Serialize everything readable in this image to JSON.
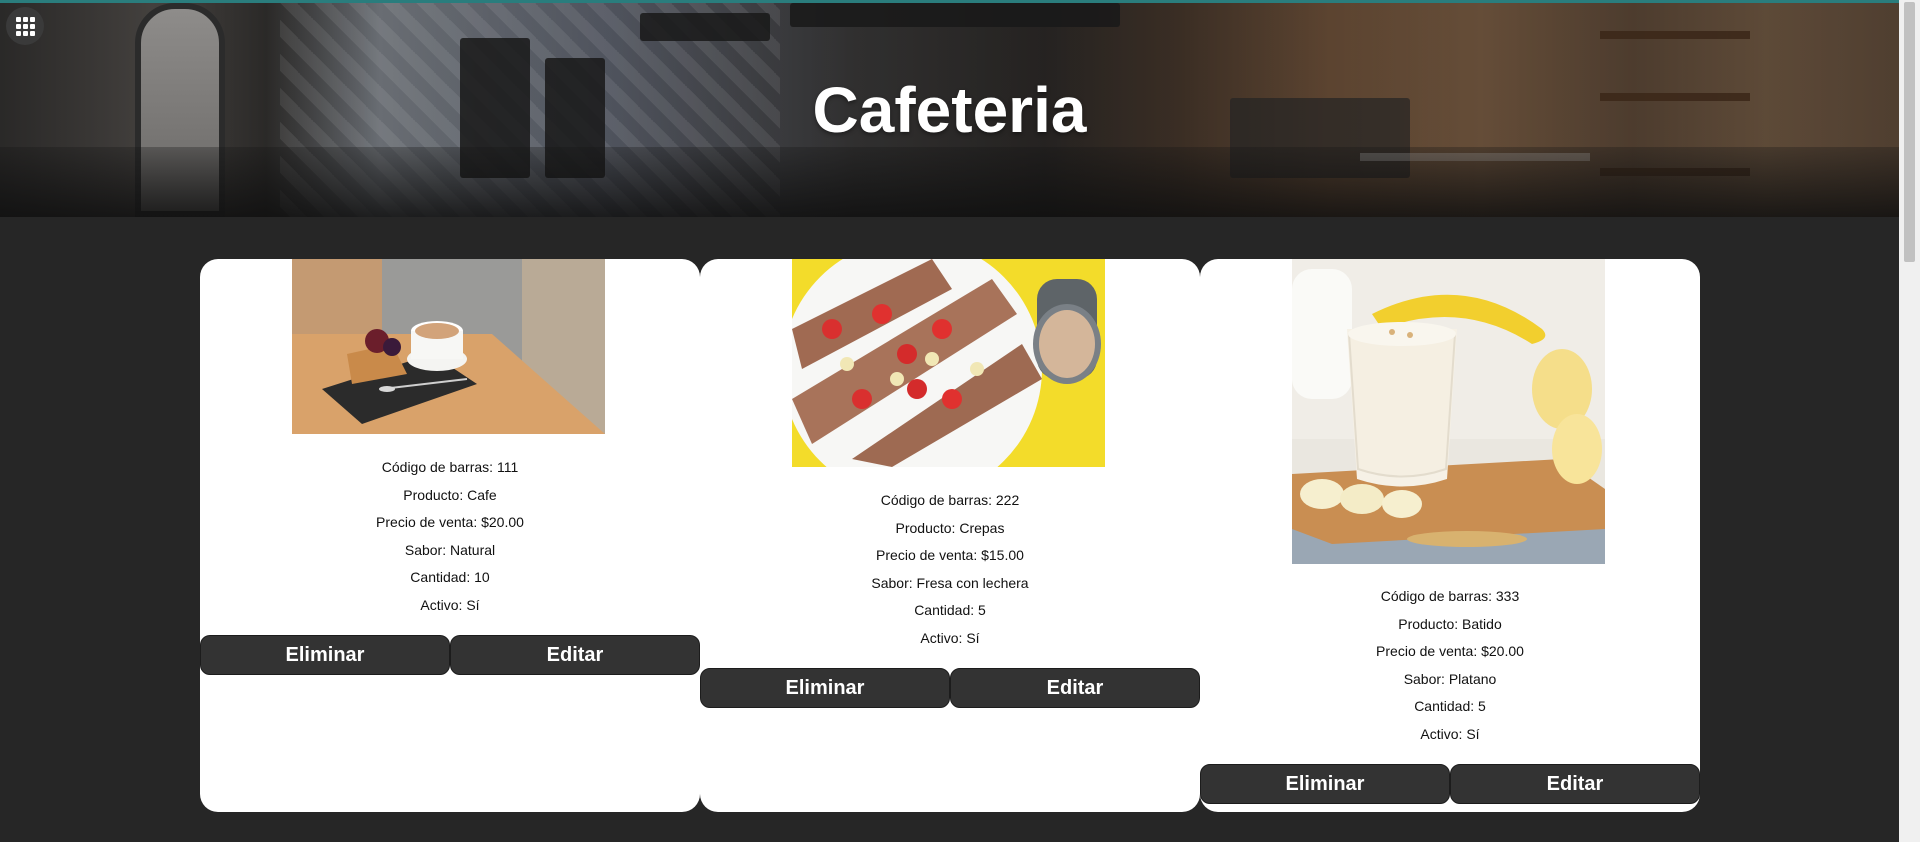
{
  "header": {
    "title": "Cafeteria",
    "launcher_icon": "apps-grid-icon"
  },
  "products": [
    {
      "barcode_label": "Código de barras: 111",
      "product_label": "Producto: Cafe",
      "price_label": "Precio de venta: $20.00",
      "flavor_label": "Sabor: Natural",
      "quantity_label": "Cantidad: 10",
      "active_label": "Activo: Sí",
      "delete_label": "Eliminar",
      "edit_label": "Editar"
    },
    {
      "barcode_label": "Código de barras: 222",
      "product_label": "Producto: Crepas",
      "price_label": "Precio de venta: $15.00",
      "flavor_label": "Sabor: Fresa con lechera",
      "quantity_label": "Cantidad: 5",
      "active_label": "Activo: Sí",
      "delete_label": "Eliminar",
      "edit_label": "Editar"
    },
    {
      "barcode_label": "Código de barras: 333",
      "product_label": "Producto: Batido",
      "price_label": "Precio de venta: $20.00",
      "flavor_label": "Sabor: Platano",
      "quantity_label": "Cantidad: 5",
      "active_label": "Activo: Sí",
      "delete_label": "Eliminar",
      "edit_label": "Editar"
    }
  ],
  "colors": {
    "background": "#262626",
    "card": "#ffffff",
    "button": "#333333",
    "button_text": "#ffffff"
  }
}
